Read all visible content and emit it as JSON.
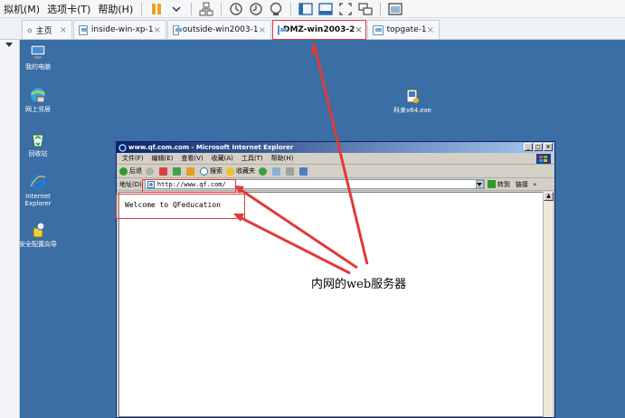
{
  "host": {
    "menus": [
      "拟机(M)",
      "选项卡(T)",
      "帮助(H)"
    ],
    "panel_close": "×",
    "tabs": [
      {
        "label": "主页",
        "active": false
      },
      {
        "label": "inside-win-xp-1",
        "active": false
      },
      {
        "label": "outside-win2003-1",
        "active": false
      },
      {
        "label": "DMZ-win2003-2",
        "active": true
      },
      {
        "label": "topgate-1",
        "active": false
      }
    ],
    "tab_close": "×"
  },
  "desktop": {
    "icons": [
      {
        "label": "我的电脑",
        "icon": "my-computer-icon"
      },
      {
        "label": "网上邻居",
        "icon": "network-places-icon"
      },
      {
        "label": "回收站",
        "icon": "recycle-bin-icon"
      },
      {
        "label": "Internet Explorer",
        "icon": "internet-explorer-icon"
      },
      {
        "label": "安全配置向导",
        "icon": "security-wizard-icon"
      },
      {
        "label": "科来x64.exe",
        "icon": "installer-icon"
      }
    ]
  },
  "ie": {
    "title": "www.qf.com.com - Microsoft Internet Explorer",
    "window_buttons": [
      "_",
      "□",
      "×"
    ],
    "menus": [
      "文件(F)",
      "编辑(E)",
      "查看(V)",
      "收藏(A)",
      "工具(T)",
      "帮助(H)"
    ],
    "toolbar": {
      "back": "后退",
      "search": "搜索",
      "favorites": "收藏夹"
    },
    "address_label": "地址(D)",
    "address_value": "http://www.qf.com/",
    "go_label": "转到",
    "links_label": "链接",
    "links_chevron": "»",
    "page_text": "Welcome to QFeducation"
  },
  "annotation": {
    "text": "内网的web服务器",
    "color": "#e03a3a"
  }
}
